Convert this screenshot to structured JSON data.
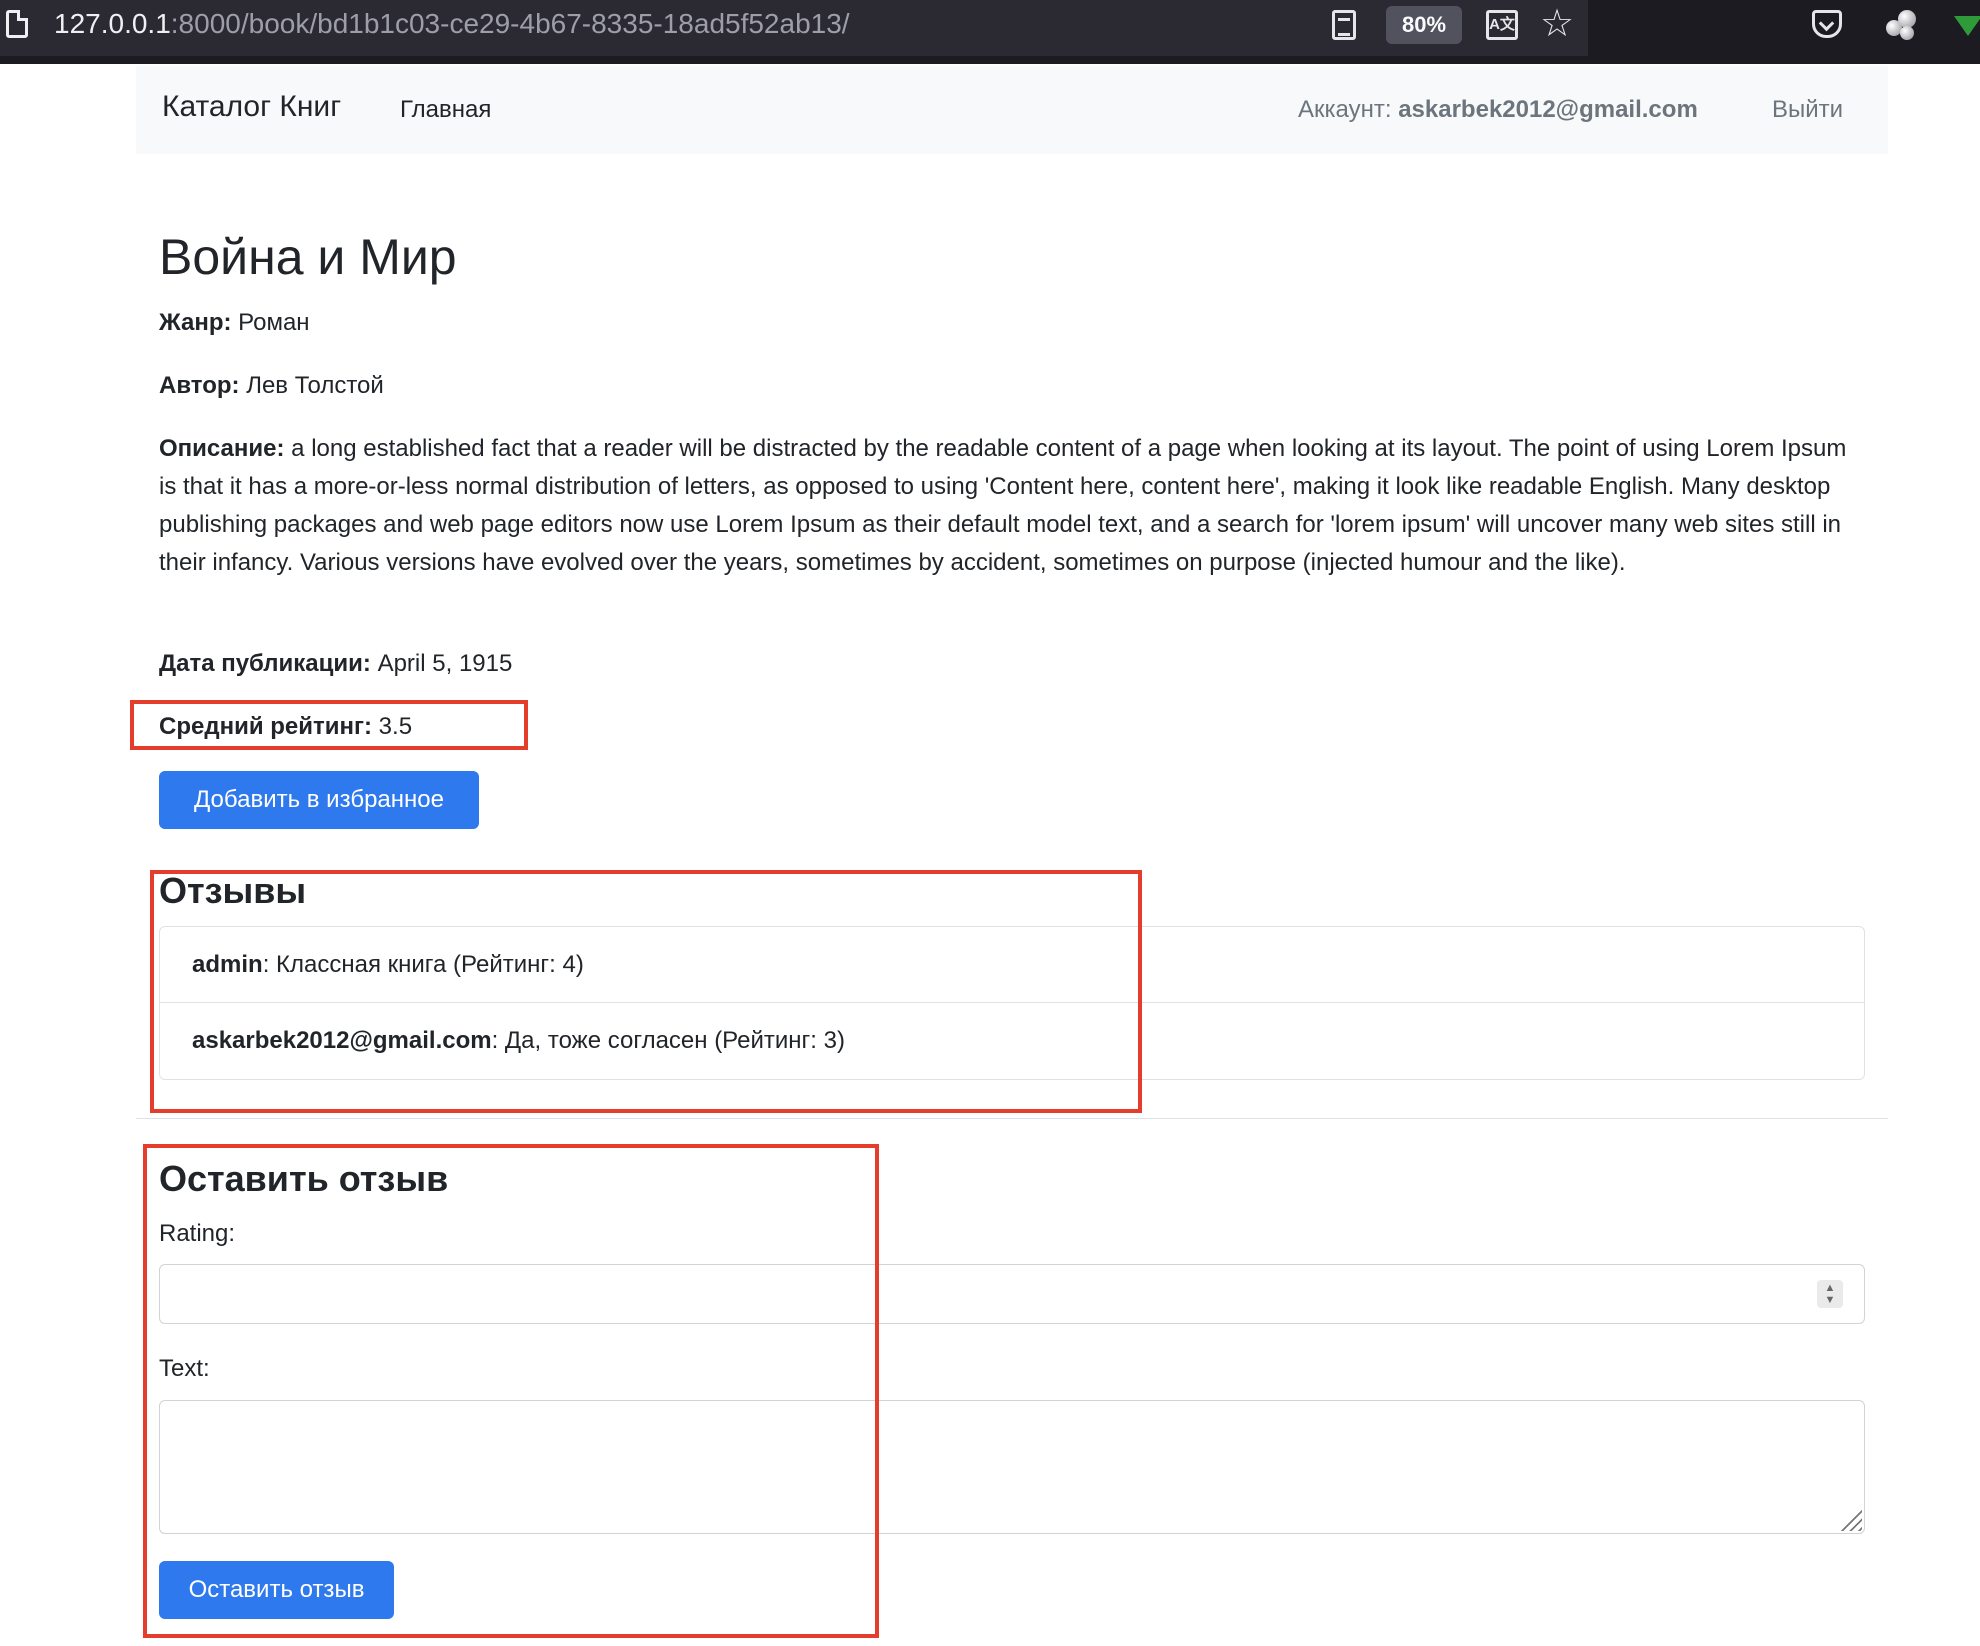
{
  "browser": {
    "url_host": "127.0.0.1",
    "url_path": ":8000/book/bd1b1c03-ce29-4b67-8335-18ad5f52ab13/",
    "zoom": "80%",
    "icons": [
      "page-icon",
      "reader-view-icon",
      "translate-icon",
      "bookmark-star-icon",
      "pocket-icon",
      "extension-icon",
      "download-arrow-icon"
    ]
  },
  "navbar": {
    "brand": "Каталог Книг",
    "home": "Главная",
    "account_label": "Аккаунт:",
    "account_email": "askarbek2012@gmail.com",
    "logout": "Выйти"
  },
  "book": {
    "title": "Война и Мир",
    "genre_label": "Жанр:",
    "genre": "Роман",
    "author_label": "Автор:",
    "author": "Лев Толстой",
    "description_label": "Описание:",
    "description": "a long established fact that a reader will be distracted by the readable content of a page when looking at its layout. The point of using Lorem Ipsum is that it has a more-or-less normal distribution of letters, as opposed to using 'Content here, content here', making it look like readable English. Many desktop publishing packages and web page editors now use Lorem Ipsum as their default model text, and a search for 'lorem ipsum' will uncover many web sites still in their infancy. Various versions have evolved over the years, sometimes by accident, sometimes on purpose (injected humour and the like).",
    "pubdate_label": "Дата публикации:",
    "pubdate": "April 5, 1915",
    "rating_label": "Средний рейтинг:",
    "rating": "3.5",
    "favorite_button": "Добавить в избранное"
  },
  "reviews": {
    "heading": "Отзывы",
    "items": [
      {
        "user": "admin",
        "text": ": Классная книга (Рейтинг: 4)"
      },
      {
        "user": "askarbek2012@gmail.com",
        "text": ": Да, тоже согласен (Рейтинг: 3)"
      }
    ]
  },
  "review_form": {
    "heading": "Оставить отзыв",
    "rating_label": "Rating:",
    "rating_value": "",
    "text_label": "Text:",
    "text_value": "",
    "submit": "Оставить отзыв"
  },
  "colors": {
    "primary_button": "#2f79ee",
    "annotation_red": "#e53d2b",
    "navbar_bg": "#f8f9fa",
    "browser_bg": "#2b2a33"
  }
}
